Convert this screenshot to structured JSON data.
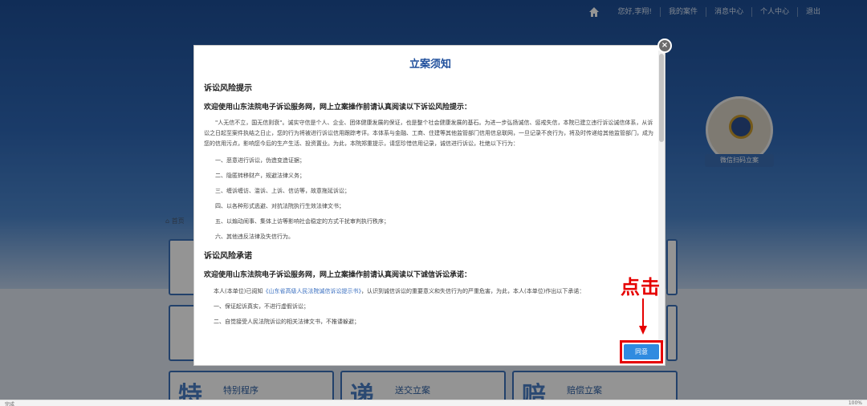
{
  "topnav": {
    "items": [
      "您好,李翔!",
      "我的案件",
      "消息中心",
      "个人中心",
      "退出"
    ]
  },
  "qr": {
    "label": "微信扫码立案"
  },
  "breadcrumb": "首页",
  "tiles": {
    "row3": [
      "特别程序",
      "送交立案",
      "赔偿立案"
    ]
  },
  "modal": {
    "title": "立案须知",
    "section1": {
      "heading": "诉讼风险提示",
      "intro": "欢迎使用山东法院电子诉讼服务网，网上立案操作前请认真阅读以下诉讼风险提示：",
      "paragraph": "\"人无信不立，国无信则衰\"。诚实守信是个人、企业、团体健康发展的保证，也是整个社会健康发展的基石。为进一步弘扬诚信、惩戒失信，本院已建立违行诉讼诚信体系，从诉讼之日起至案件执结之日止，您的行为将被进行诉讼信用跟踪考评。本体系与金融、工商、住建等其他监管部门信用信息联网，一旦记录不良行为，将及时传递给其他监管部门，成为您的信用污点，影响您今后的生产生活、投资置业。为此，本院郑重提示，请您珍惜信用记录，诚信进行诉讼，杜绝以下行为：",
      "items": [
        "一、恶意进行诉讼，伪造变造证据；",
        "二、隐匿转移财产，规避法律义务；",
        "三、缠诉缠访、滥诉、上诉、信访等，故意拖延诉讼；",
        "四、以各种形式逃避、对抗法院执行生效法律文书；",
        "五、以煽动闹事、集体上访等影响社会稳定的方式干扰审判执行秩序；",
        "六、其他违反法律及失信行为。"
      ]
    },
    "section2": {
      "heading": "诉讼风险承诺",
      "intro": "欢迎使用山东法院电子诉讼服务网，网上立案操作前请认真阅读以下诚信诉讼承诺：",
      "paragraph_prefix": "本人(本单位)已阅知",
      "paragraph_link": "《山东省高级人民法院诚信诉讼提示书》",
      "paragraph_suffix": "，认识到诚信诉讼的重要意义和失信行为的严重危害，为此，本人(本单位)作出以下承诺：",
      "items": [
        "一、保证起诉真实，不进行虚假诉讼；",
        "二、自觉接受人民法院诉讼的相关法律文书，不推诿躲避；"
      ]
    },
    "agree_button": "同意"
  },
  "annotation": {
    "text": "点击"
  },
  "statusbar": {
    "left": "完成",
    "right": "100%"
  },
  "colors": {
    "accent": "#1f4f9c",
    "button": "#2f8be0",
    "annotation": "#e60000"
  }
}
